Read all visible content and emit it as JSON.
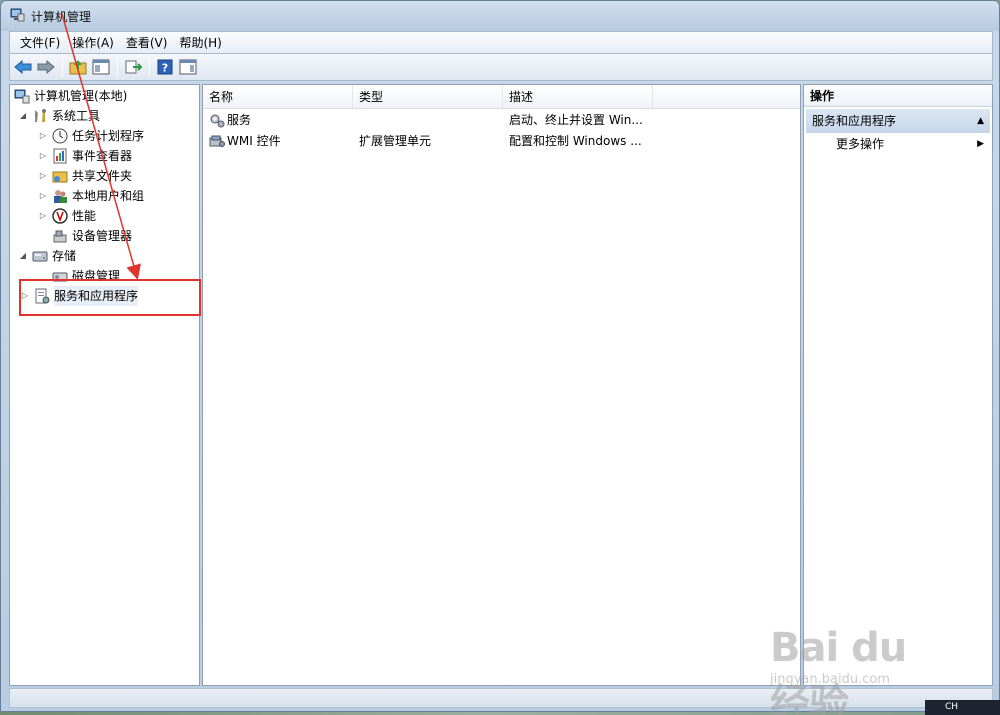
{
  "window": {
    "title": "计算机管理"
  },
  "menu": [
    "文件(F)",
    "操作(A)",
    "查看(V)",
    "帮助(H)"
  ],
  "toolbar": {
    "buttons": [
      "back-arrow-icon",
      "forward-arrow-icon",
      "up-folder-icon",
      "show-hide-tree-icon",
      "export-list-icon",
      "help-icon",
      "show-hide-action-pane-icon"
    ]
  },
  "tree": {
    "root": "计算机管理(本地)",
    "system_tools": "系统工具",
    "task_scheduler": "任务计划程序",
    "event_viewer": "事件查看器",
    "shared_folders": "共享文件夹",
    "local_users": "本地用户和组",
    "performance": "性能",
    "device_manager": "设备管理器",
    "storage": "存储",
    "disk_management": "磁盘管理",
    "services_apps": "服务和应用程序"
  },
  "list": {
    "columns": [
      "名称",
      "类型",
      "描述"
    ],
    "rows": [
      {
        "name": "服务",
        "type": "",
        "desc": "启动、终止并设置 Win..."
      },
      {
        "name": "WMI 控件",
        "type": "扩展管理单元",
        "desc": "配置和控制 Windows ..."
      }
    ]
  },
  "actions": {
    "header": "操作",
    "section": "服务和应用程序",
    "more": "更多操作"
  },
  "watermark": {
    "main": "Bai du 经验",
    "sub": "jingyan.baidu.com"
  },
  "taskbar": {
    "lang": "CH"
  },
  "colors": {
    "highlight": "#e0332e",
    "selected_bg": "#e8eef7",
    "action_section": "#c6d6ea"
  }
}
